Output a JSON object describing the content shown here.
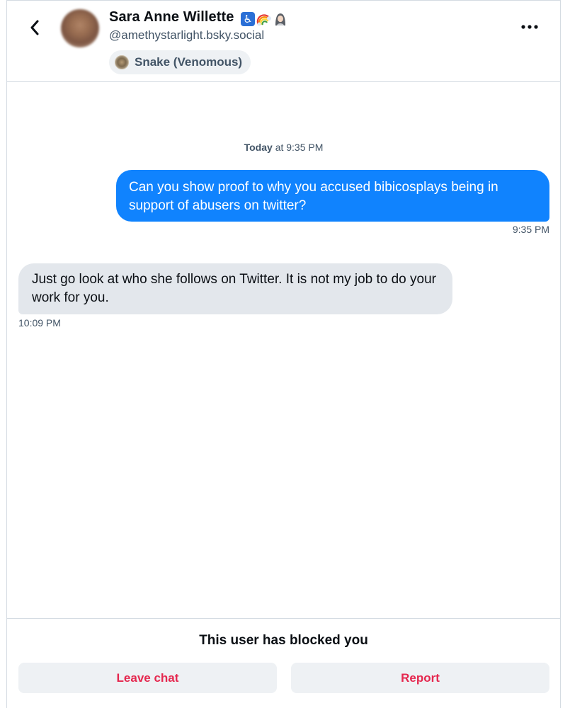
{
  "header": {
    "back_icon": "chevron-left-icon",
    "avatar_icon": "avatar",
    "name": "Sara Anne Willette",
    "name_emojis": [
      "♿",
      "🌈",
      "🧕"
    ],
    "handle": "@amethystarlight.bsky.social",
    "label": "Snake (Venomous)",
    "more_icon": "more-horizontal-icon"
  },
  "conversation": {
    "date_header_day": "Today",
    "date_header_time": "at 9:35 PM",
    "messages": [
      {
        "direction": "sent",
        "text": "Can you show proof to why you accused bibicosplays being in support of abusers on twitter?",
        "time": "9:35 PM"
      },
      {
        "direction": "received",
        "text": "Just go look at who she follows on Twitter. It is not my job to do your work for you.",
        "time": "10:09 PM"
      }
    ]
  },
  "footer": {
    "blocked_message": "This user has blocked you",
    "leave_label": "Leave chat",
    "report_label": "Report"
  },
  "colors": {
    "accent": "#1083fe",
    "danger": "#e5284f",
    "received_bubble": "#e3e7ec",
    "muted_text": "#425466"
  }
}
